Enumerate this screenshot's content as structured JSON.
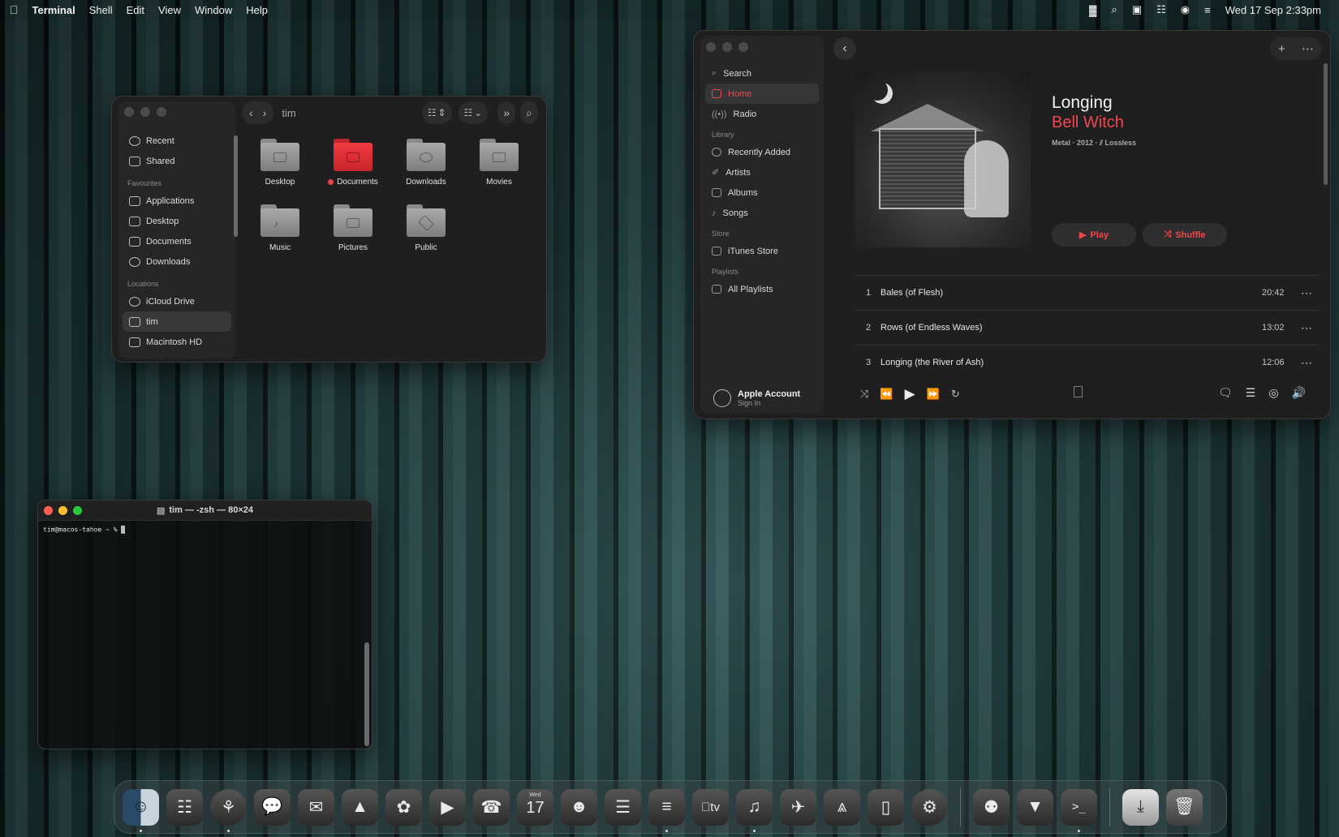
{
  "menubar": {
    "app": "Terminal",
    "items": [
      "Shell",
      "Edit",
      "View",
      "Window",
      "Help"
    ],
    "datetime": "Wed 17 Sep  2:33pm"
  },
  "finder": {
    "path_title": "tim",
    "sidebar_top": [
      "Recent",
      "Shared"
    ],
    "favourites_label": "Favourites",
    "favourites": [
      "Applications",
      "Desktop",
      "Documents",
      "Downloads"
    ],
    "locations_label": "Locations",
    "locations": [
      "iCloud Drive",
      "tim",
      "Macintosh HD"
    ],
    "folders": [
      "Desktop",
      "Documents",
      "Downloads",
      "Movies",
      "Music",
      "Pictures",
      "Public"
    ]
  },
  "music": {
    "search": "Search",
    "home": "Home",
    "radio": "Radio",
    "library_label": "Library",
    "library": [
      "Recently Added",
      "Artists",
      "Albums",
      "Songs"
    ],
    "store_label": "Store",
    "store": [
      "iTunes Store"
    ],
    "playlists_label": "Playlists",
    "playlists": [
      "All Playlists"
    ],
    "account_name": "Apple Account",
    "account_action": "Sign In",
    "album": "Longing",
    "artist": "Bell Witch",
    "meta": "Metal · 2012 · ",
    "lossless": "Lossless",
    "play": "Play",
    "shuffle": "Shuffle",
    "tracks": [
      {
        "num": "1",
        "title": "Bales (of Flesh)",
        "dur": "20:42"
      },
      {
        "num": "2",
        "title": "Rows (of Endless Waves)",
        "dur": "13:02"
      },
      {
        "num": "3",
        "title": "Longing (the River of Ash)",
        "dur": "12:06"
      }
    ]
  },
  "terminal": {
    "title": "tim — -zsh — 80×24",
    "prompt": "tim@macos-tahoe ~ % "
  },
  "dock": {
    "calendar_day": "Wed",
    "calendar_date": "17",
    "appletv": "tv"
  },
  "colors": {
    "accent": "#f0484e",
    "folder_red": "#e8454a",
    "window_bg": "#1f1f1f"
  }
}
